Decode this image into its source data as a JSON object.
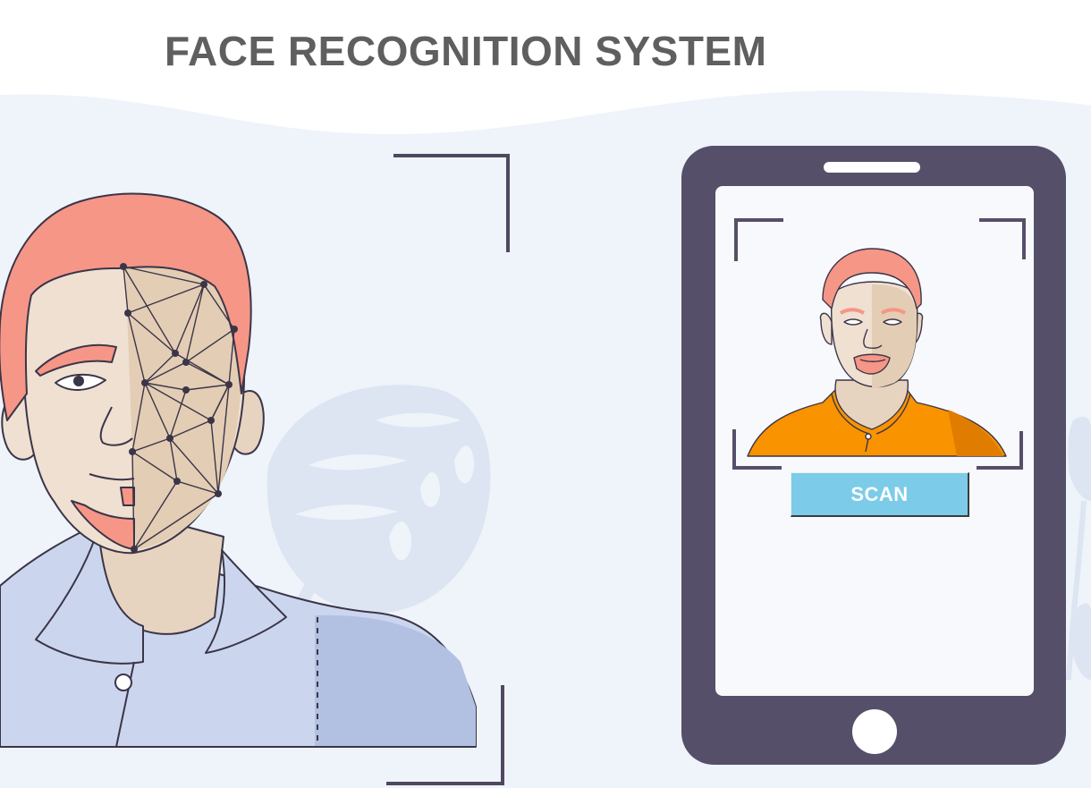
{
  "header": {
    "title": "FACE RECOGNITION SYSTEM"
  },
  "phone": {
    "scan_button_label": "SCAN"
  },
  "colors": {
    "background_wave": "#eff3fa",
    "phone_frame": "#564f6a",
    "phone_screen": "#f8f9fc",
    "scan_button": "#7ccbe8",
    "hair": "#f69686",
    "skin": "#efe0d2",
    "shirt_left": "#cbd6ee",
    "shirt_right": "#f99300",
    "title_text": "#5f5f5f"
  }
}
